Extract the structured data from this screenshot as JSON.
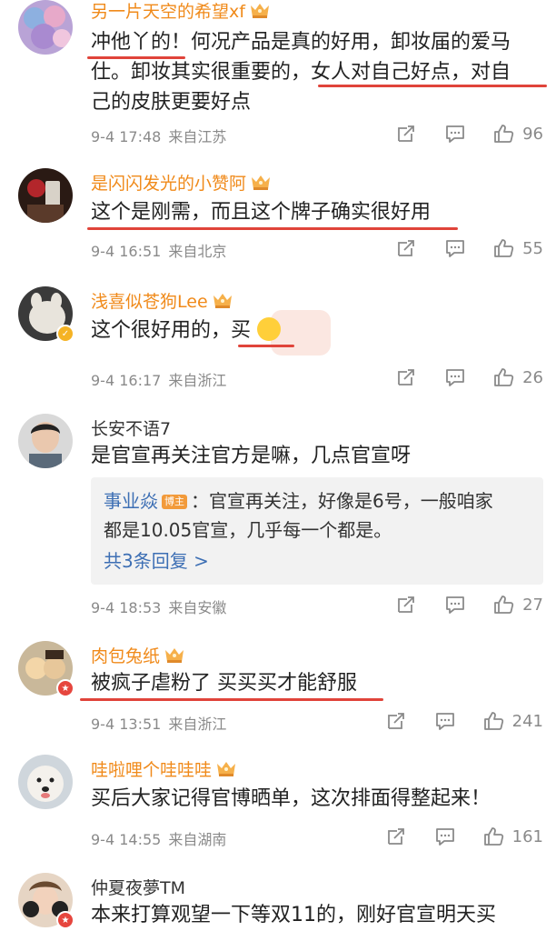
{
  "comments": [
    {
      "name": "另一片天空的希望xf",
      "line1": "冲他丫的！何况产品是真的好用，卸妆届的爱马",
      "line2": "仕。卸妆其实很重要的，女人对自己好点，对自",
      "line3": "己的皮肤更要好点",
      "date": "9-4 17:48",
      "location": "来自江苏",
      "likes": "96"
    },
    {
      "name": "是闪闪发光的小赞阿",
      "line1": "这个是刚需，而且这个牌子确实很好用",
      "date": "9-4 16:51",
      "location": "来自北京",
      "likes": "55"
    },
    {
      "name": "浅喜似苍狗Lee",
      "line1": "这个很好用的，买",
      "date": "9-4 16:17",
      "location": "来自浙江",
      "likes": "26"
    },
    {
      "name": "长安不语7",
      "line1": "是官宣再关注官方是嘛，几点官宣呀",
      "reply": {
        "name": "事业焱",
        "badge": "博主",
        "text1": "：官宣再关注，好像是6号，一般咱家",
        "text2": "都是10.05官宣，几乎每一个都是。",
        "more": "共3条回复 >"
      },
      "date": "9-4 18:53",
      "location": "来自安徽",
      "likes": "27"
    },
    {
      "name": "肉包兔纸",
      "line1": "被疯子虐粉了 买买买才能舒服",
      "date": "9-4 13:51",
      "location": "来自浙江",
      "likes": "241"
    },
    {
      "name": "哇啦哩个哇哇哇",
      "line1": "买后大家记得官博晒单，这次排面得整起来！",
      "date": "9-4 14:55",
      "location": "来自湖南",
      "likes": "161"
    },
    {
      "name": "仲夏夜夢TM",
      "line1": "本来打算观望一下等双11的，刚好官宣明天买"
    }
  ],
  "colors": {
    "vip_name": "#f08a1a",
    "underline": "#e0443a",
    "link": "#3d6fb4"
  },
  "icons": {
    "share": "share-icon",
    "reply": "comment-icon",
    "like": "thumbs-up-icon",
    "vip": "crown-icon"
  }
}
